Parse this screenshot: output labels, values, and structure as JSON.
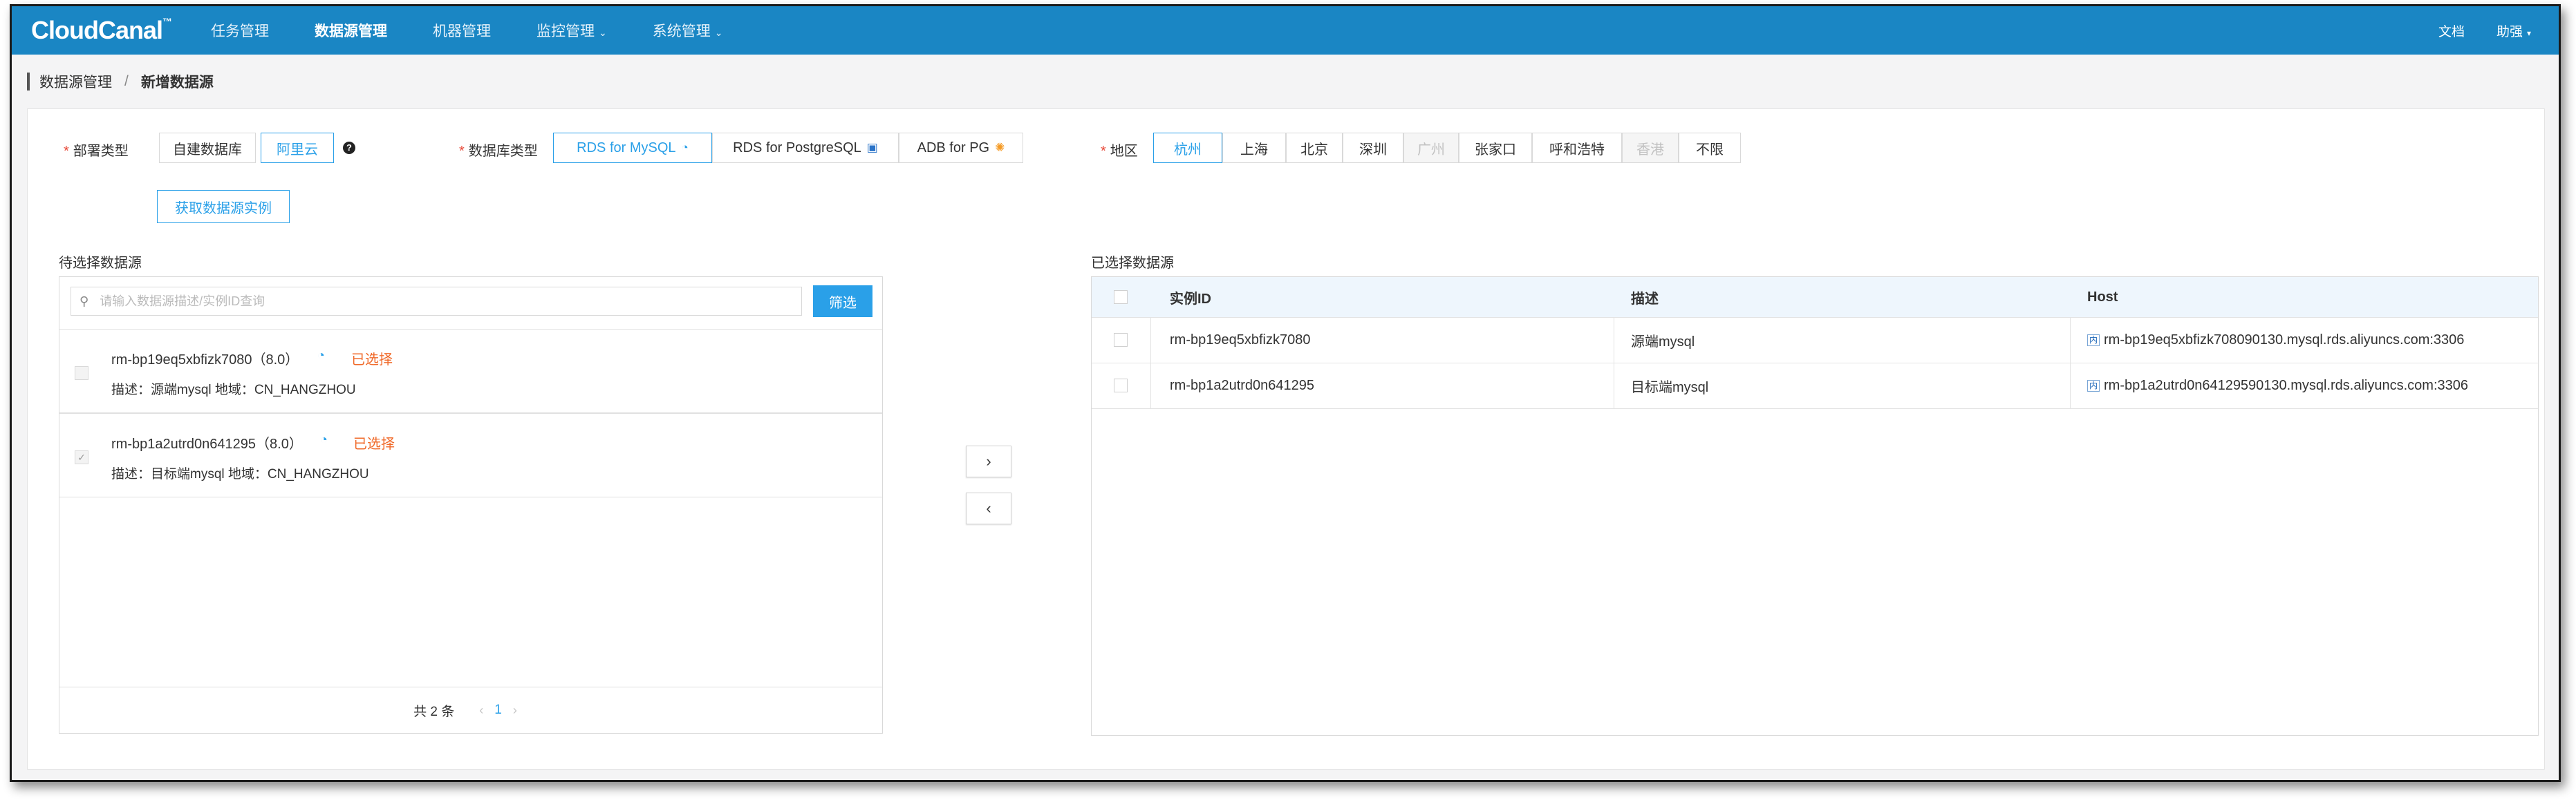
{
  "app": {
    "logo": "CloudCanal",
    "logo_mark": "™",
    "nav": [
      {
        "label": "任务管理",
        "dropdown": false,
        "active": false
      },
      {
        "label": "数据源管理",
        "dropdown": false,
        "active": true
      },
      {
        "label": "机器管理",
        "dropdown": false,
        "active": false
      },
      {
        "label": "监控管理",
        "dropdown": true,
        "active": false
      },
      {
        "label": "系统管理",
        "dropdown": true,
        "active": false
      }
    ],
    "docs": "文档",
    "user": "助强"
  },
  "breadcrumb": {
    "parent": "数据源管理",
    "separator": "/",
    "current": "新增数据源"
  },
  "form": {
    "deploy_label": "部署类型",
    "deploy_options": [
      "自建数据库",
      "阿里云"
    ],
    "deploy_selected": "阿里云",
    "dbtype_label": "数据库类型",
    "dbtype_options": [
      "RDS for MySQL",
      "RDS for PostgreSQL",
      "ADB for PG"
    ],
    "dbtype_selected": "RDS for MySQL",
    "region_label": "地区",
    "regions": [
      {
        "label": "杭州",
        "state": "selected"
      },
      {
        "label": "上海",
        "state": "normal"
      },
      {
        "label": "北京",
        "state": "normal"
      },
      {
        "label": "深圳",
        "state": "normal"
      },
      {
        "label": "广州",
        "state": "disabled"
      },
      {
        "label": "张家口",
        "state": "normal"
      },
      {
        "label": "呼和浩特",
        "state": "normal"
      },
      {
        "label": "香港",
        "state": "disabled"
      },
      {
        "label": "不限",
        "state": "normal"
      }
    ],
    "fetch_button": "获取数据源实例",
    "help_icon": "?"
  },
  "pending": {
    "title": "待选择数据源",
    "search_placeholder": "请输入数据源描述/实例ID查询",
    "filter_button": "筛选",
    "items": [
      {
        "name": "rm-bp19eq5xbfizk7080（8.0）",
        "status": "已选择",
        "desc": "描述：源端mysql 地域：CN_HANGZHOU",
        "checked": false
      },
      {
        "name": "rm-bp1a2utrd0n641295（8.0）",
        "status": "已选择",
        "desc": "描述：目标端mysql 地域：CN_HANGZHOU",
        "checked": true
      }
    ],
    "total": "共 2 条",
    "page": "1"
  },
  "transfer": {
    "right": "›",
    "left": "‹"
  },
  "selected": {
    "title": "已选择数据源",
    "columns": [
      "实例ID",
      "描述",
      "Host"
    ],
    "rows": [
      {
        "id": "rm-bp19eq5xbfizk7080",
        "desc": "源端mysql",
        "host_tag": "内",
        "host": "rm-bp19eq5xbfizk708090130.mysql.rds.aliyuncs.com:3306"
      },
      {
        "id": "rm-bp1a2utrd0n641295",
        "desc": "目标端mysql",
        "host_tag": "内",
        "host": "rm-bp1a2utrd0n64129590130.mysql.rds.aliyuncs.com:3306"
      }
    ]
  },
  "colors": {
    "nav_bg": "#1a86c4",
    "accent": "#2aa0e8",
    "warning": "#f06a2a",
    "required": "#e84a3a"
  }
}
